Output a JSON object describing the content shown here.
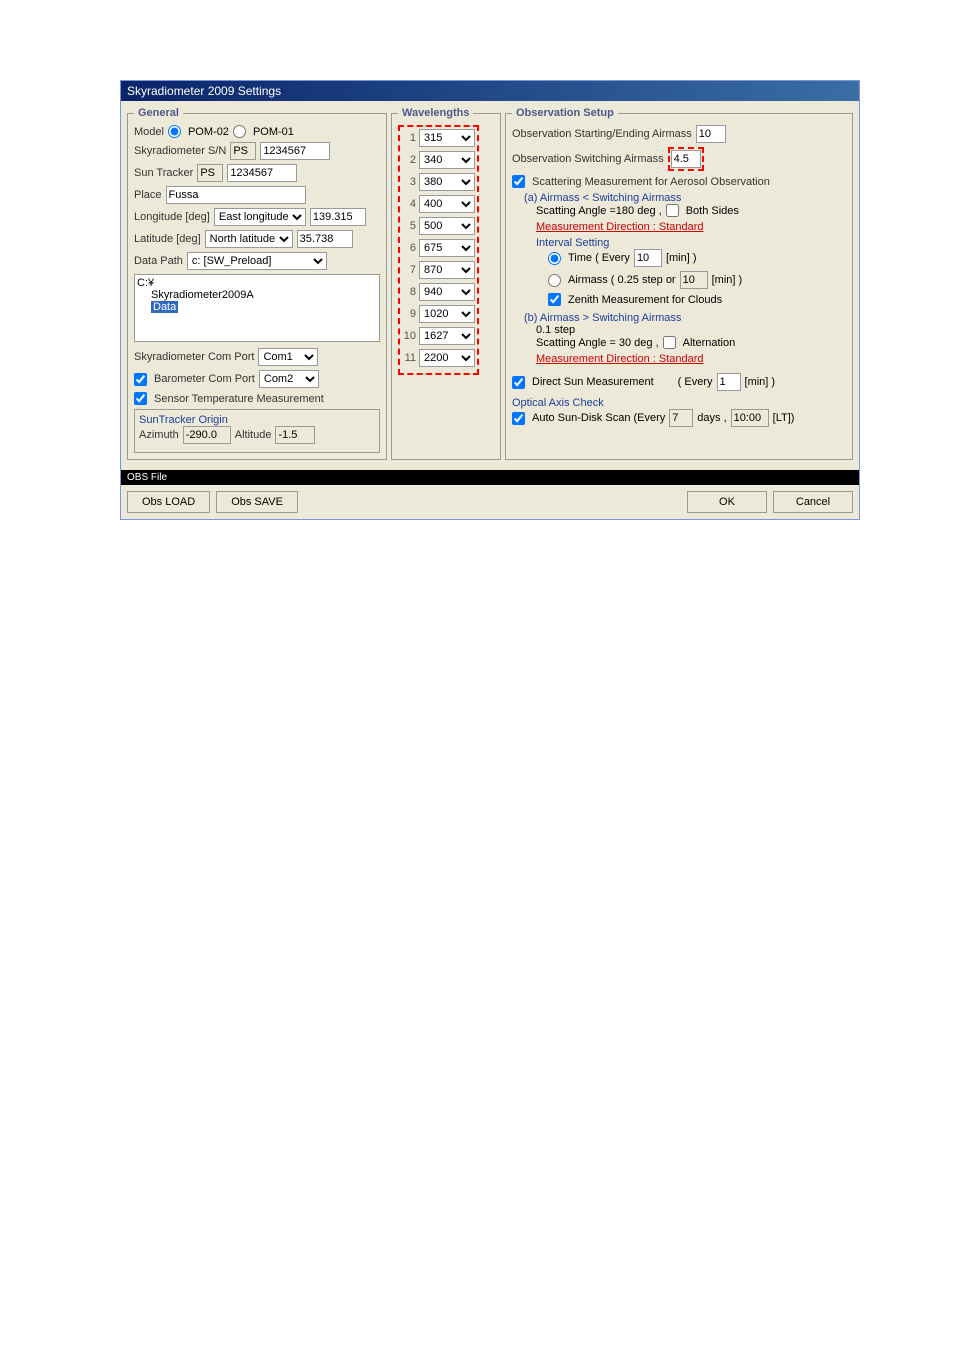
{
  "titlebar": "Skyradiometer 2009 Settings",
  "general": {
    "legend": "General",
    "model_label": "Model",
    "model_opt1": "POM-02",
    "model_opt2": "POM-01",
    "sn_label": "Skyradiometer S/N",
    "sn_prefix": "PS",
    "sn_value": "1234567",
    "tracker_label": "Sun Tracker",
    "tracker_prefix": "PS",
    "tracker_value": "1234567",
    "place_label": "Place",
    "place_value": "Fussa",
    "lon_label": "Longitude [deg]",
    "lon_dir": "East longitude",
    "lon_value": "139.315",
    "lat_label": "Latitude [deg]",
    "lat_dir": "North latitude",
    "lat_value": "35.738",
    "datapath_label": "Data Path",
    "datapath_value": "c: [SW_Preload]",
    "dir_c": "C:¥",
    "dir_sky": "Skyradiometer2009A",
    "dir_data": "Data",
    "com_label": "Skyradiometer Com Port",
    "com_value": "Com1",
    "baro_label": "Barometer Com Port",
    "baro_value": "Com2",
    "sensor_label": "Sensor Temperature Measurement",
    "origin_label": "SunTracker Origin",
    "az_label": "Azimuth",
    "az_value": "-290.0",
    "alt_label": "Altitude",
    "alt_value": "-1.5"
  },
  "wavelengths": {
    "legend": "Wavelengths",
    "items": [
      {
        "n": "1",
        "v": "315"
      },
      {
        "n": "2",
        "v": "340"
      },
      {
        "n": "3",
        "v": "380"
      },
      {
        "n": "4",
        "v": "400"
      },
      {
        "n": "5",
        "v": "500"
      },
      {
        "n": "6",
        "v": "675"
      },
      {
        "n": "7",
        "v": "870"
      },
      {
        "n": "8",
        "v": "940"
      },
      {
        "n": "9",
        "v": "1020"
      },
      {
        "n": "10",
        "v": "1627"
      },
      {
        "n": "11",
        "v": "2200"
      }
    ]
  },
  "obs": {
    "legend": "Observation Setup",
    "start_end_label": "Observation Starting/Ending Airmass",
    "start_end_value": "10",
    "switch_label": "Observation Switching Airmass",
    "switch_value": "4.5",
    "scatter_label": "Scattering Measurement for Aerosol Observation",
    "a_header": "(a) Airmass <  Switching Airmass",
    "a_scat": "Scatting Angle =180 deg ,",
    "both_sides": "Both Sides",
    "meas_dir_a": "Measurement Direction : Standard",
    "interval_label": "Interval Setting",
    "time_label": "Time    ( Every",
    "time_value": "10",
    "time_unit": "[min] )",
    "airmass_label": "Airmass  ( 0.25 step or",
    "airmass_value": "10",
    "airmass_unit": "[min] )",
    "zenith_label": "Zenith Measurement for Clouds",
    "b_header": "(b) Airmass >  Switching Airmass",
    "b_step": "0.1 step",
    "b_scat": "Scatting Angle = 30 deg ,",
    "alternation": "Alternation",
    "meas_dir_b": "Measurement Direction : Standard",
    "direct_label": "Direct Sun Measurement",
    "direct_every": "( Every",
    "direct_value": "1",
    "direct_unit": "[min] )",
    "optical_label": "Optical Axis  Check",
    "auto_label": "Auto Sun-Disk Scan (Every",
    "auto_days": "7",
    "auto_days_unit": "days ,",
    "auto_time": "10:00",
    "auto_time_unit": "[LT])"
  },
  "footer": {
    "obs_file": "OBS File",
    "load": "Obs LOAD",
    "save": "Obs SAVE",
    "ok": "OK",
    "cancel": "Cancel"
  }
}
